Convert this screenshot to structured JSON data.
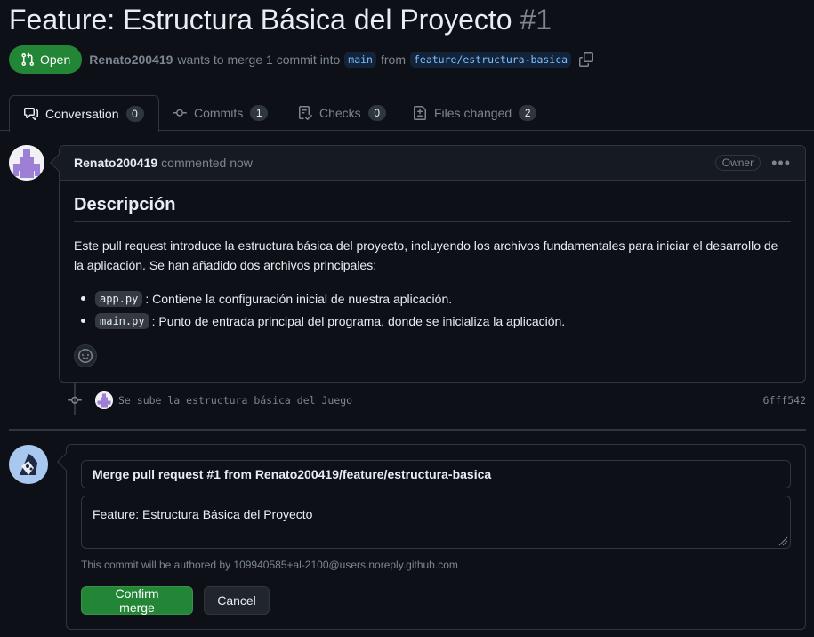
{
  "pr": {
    "title": "Feature: Estructura Básica del Proyecto",
    "number": "#1",
    "state": "Open",
    "author": "Renato200419",
    "wants_to_merge": "wants to merge 1 commit into",
    "base_branch": "main",
    "from_word": "from",
    "head_branch": "feature/estructura-basica"
  },
  "tabs": [
    {
      "label": "Conversation",
      "count": "0",
      "icon": "comment-discussion-icon"
    },
    {
      "label": "Commits",
      "count": "1",
      "icon": "git-commit-icon"
    },
    {
      "label": "Checks",
      "count": "0",
      "icon": "checklist-icon"
    },
    {
      "label": "Files changed",
      "count": "2",
      "icon": "file-diff-icon"
    }
  ],
  "comment": {
    "author": "Renato200419",
    "time": "commented now",
    "badge": "Owner",
    "heading": "Descripción",
    "paragraph": "Este pull request introduce la estructura básica del proyecto, incluyendo los archivos fundamentales para iniciar el desarrollo de la aplicación. Se han añadido dos archivos principales:",
    "items": [
      {
        "code": "app.py",
        "text": ": Contiene la configuración inicial de nuestra aplicación."
      },
      {
        "code": "main.py",
        "text": ": Punto de entrada principal del programa, donde se inicializa la aplicación."
      }
    ]
  },
  "commit": {
    "message": "Se sube la estructura básica del Juego",
    "sha": "6fff542"
  },
  "merge": {
    "title_value": "Merge pull request #1 from Renato200419/feature/estructura-basica",
    "body_value": "Feature: Estructura Básica del Proyecto",
    "note": "This commit will be authored by 109940585+al-2100@users.noreply.github.com",
    "confirm_label": "Confirm merge",
    "cancel_label": "Cancel"
  },
  "colors": {
    "background": "#0d1117",
    "accent_green": "#238636",
    "border": "#30363d",
    "muted": "#7d8590",
    "branch_text": "#79c0ff"
  }
}
